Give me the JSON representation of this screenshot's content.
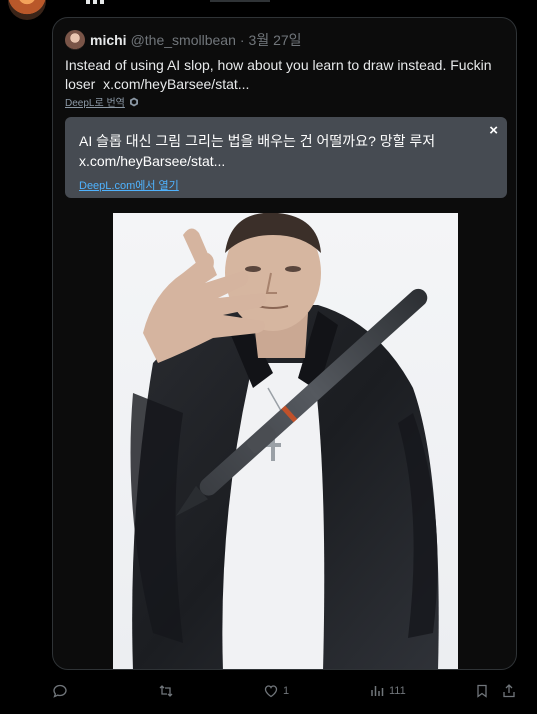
{
  "quote": {
    "author_name": "michi",
    "author_handle": "@the_smollbean",
    "separator": "·",
    "date": "3월 27일",
    "text": "Instead of using AI slop, how about you learn to draw instead. Fuckin loser",
    "link": "x.com/heyBarsee/stat...",
    "translate_label": "DeepL로 번역",
    "translation": {
      "text": "AI 슬롭 대신 그림 그리는 법을 배우는 건 어떨까요? 망할 루저",
      "link": "x.com/heyBarsee/stat...",
      "open_label": "DeepL.com에서 열기",
      "close_symbol": "×"
    }
  },
  "actions": {
    "reply_count": "",
    "retweet_count": "",
    "like_count": "1",
    "views_count": "111"
  },
  "colors": {
    "background": "#000000",
    "border": "#2f3336",
    "muted": "#71767b",
    "deepl_box": "#464b52",
    "deepl_link": "#4fb3ff"
  },
  "icons": [
    "reply-icon",
    "retweet-icon",
    "like-icon",
    "views-icon",
    "bookmark-icon",
    "share-icon",
    "deepl-hex-icon"
  ]
}
